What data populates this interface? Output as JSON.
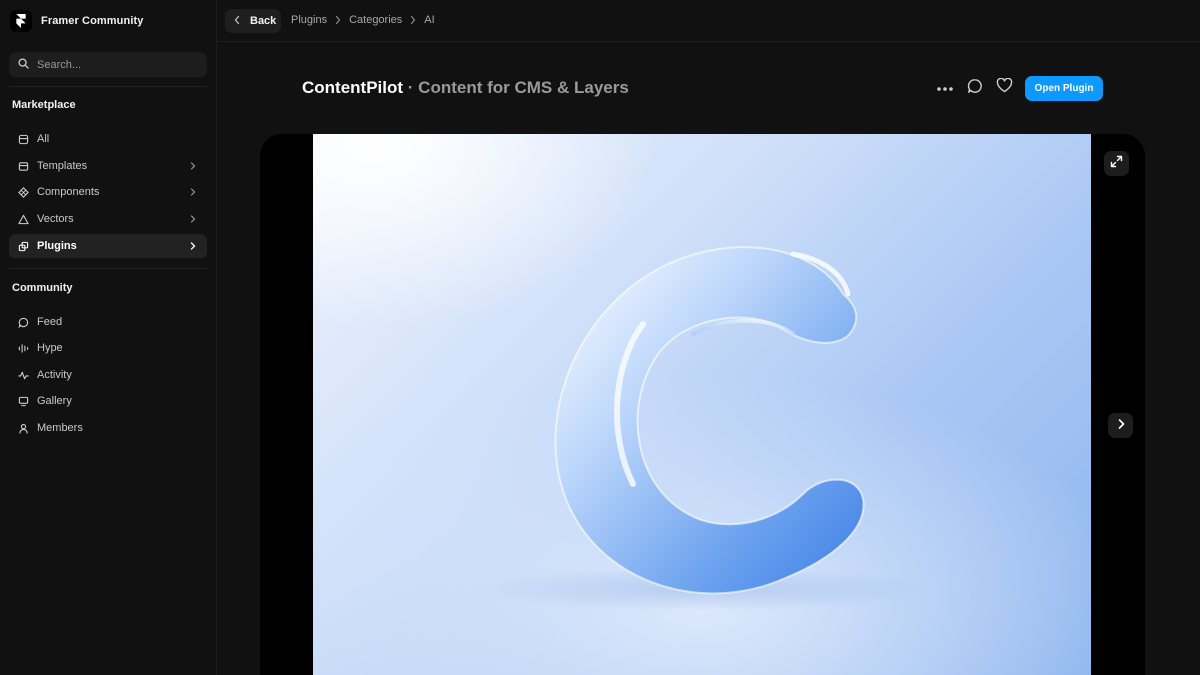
{
  "brand": {
    "name": "Framer Community"
  },
  "search": {
    "placeholder": "Search..."
  },
  "sidebar": {
    "marketplace_title": "Marketplace",
    "marketplace_items": [
      {
        "label": "All",
        "icon": "box-icon"
      },
      {
        "label": "Templates",
        "icon": "template-icon",
        "has_chevron": true
      },
      {
        "label": "Components",
        "icon": "components-icon",
        "has_chevron": true
      },
      {
        "label": "Vectors",
        "icon": "triangle-icon",
        "has_chevron": true
      },
      {
        "label": "Plugins",
        "icon": "plugin-icon",
        "has_chevron": true,
        "active": true
      }
    ],
    "community_title": "Community",
    "community_items": [
      {
        "label": "Feed",
        "icon": "chat-bubble-icon"
      },
      {
        "label": "Hype",
        "icon": "bars-icon"
      },
      {
        "label": "Activity",
        "icon": "pulse-icon"
      },
      {
        "label": "Gallery",
        "icon": "monitor-icon"
      },
      {
        "label": "Members",
        "icon": "person-icon"
      }
    ]
  },
  "topbar": {
    "back_label": "Back",
    "breadcrumbs": [
      "Plugins",
      "Categories",
      "AI"
    ]
  },
  "header": {
    "title": "ContentPilot",
    "subtitle": "· Content for CMS & Layers",
    "open_button": "Open Plugin"
  },
  "colors": {
    "accent": "#0d99ff",
    "background": "#111111",
    "sidebar_active": "#222222"
  }
}
